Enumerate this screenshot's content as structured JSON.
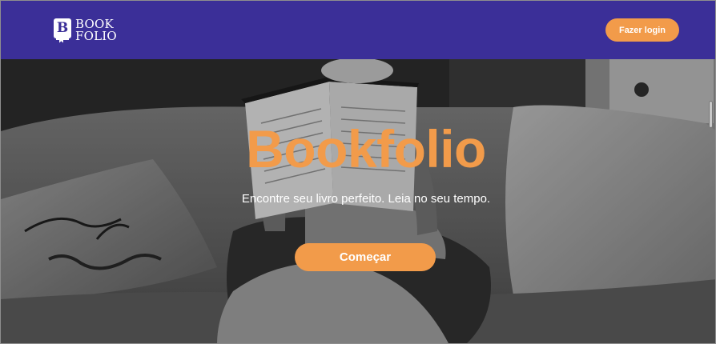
{
  "header": {
    "logo_letter": "B",
    "logo_line1": "BOOK",
    "logo_line2": "FOLIO",
    "login_label": "Fazer login"
  },
  "hero": {
    "title": "Bookfolio",
    "subtitle": "Encontre seu livro perfeito. Leia no seu tempo.",
    "cta_label": "Começar",
    "cushion_text_1": "bless",
    "cushion_text_2": "est"
  },
  "colors": {
    "header_bg": "#3b2f98",
    "accent": "#f29b4a",
    "text_light": "#ffffff"
  }
}
